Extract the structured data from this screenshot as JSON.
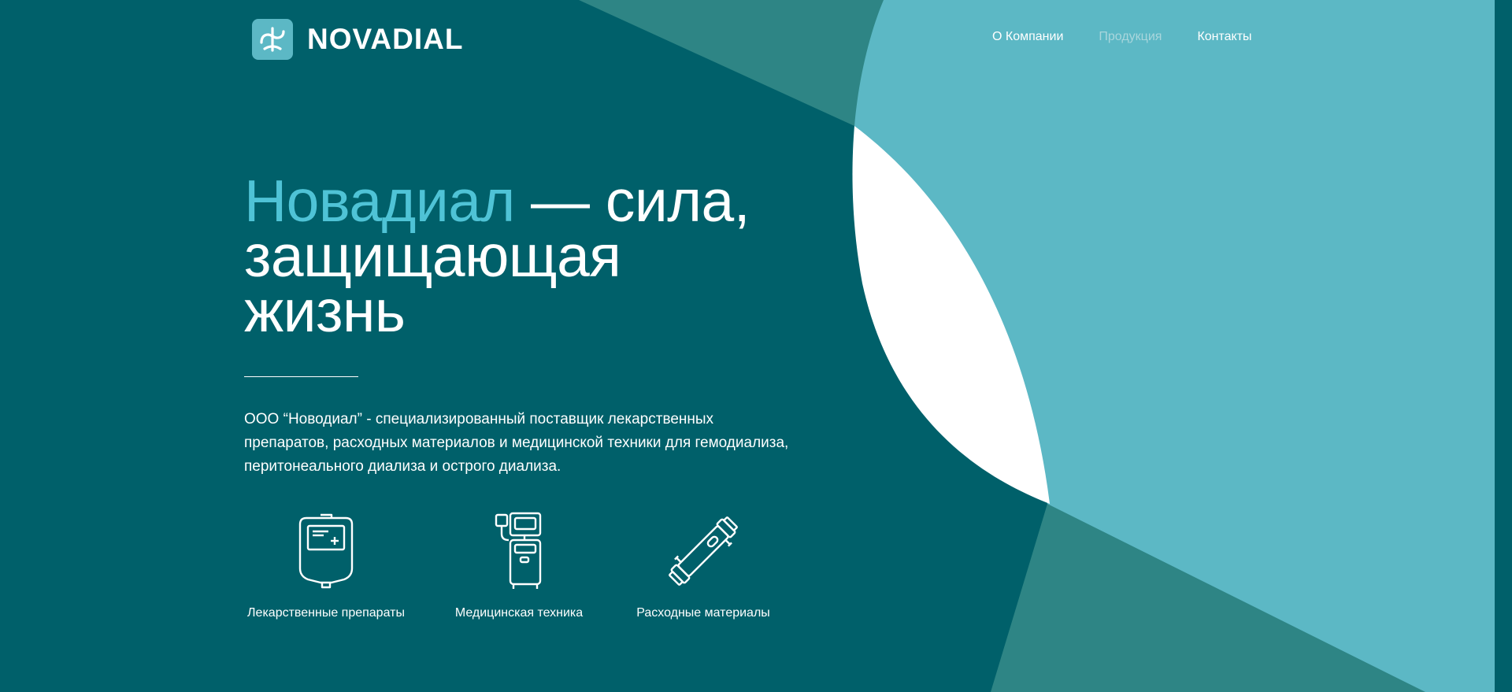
{
  "brand": {
    "name": "NOVADIAL",
    "colors": {
      "primary_bg": "#00606a",
      "accent": "#4fc3d6",
      "light_teal": "#5cb8c5",
      "mid_teal": "#2e8585"
    }
  },
  "nav": {
    "items": [
      {
        "label": "О Компании"
      },
      {
        "label": "Продукция",
        "active": true
      },
      {
        "label": "Контакты"
      }
    ]
  },
  "hero": {
    "title_accent": "Новадиал",
    "title_line1_rest": " — сила,",
    "title_line2": "защищающая",
    "title_line3": "жизнь",
    "description": "ООО “Новодиал” - специализированный поставщик лекарственных препаратов, расходных материалов и медицинской техники для гемодиализа, перитонеального диализа и острого диализа."
  },
  "categories": [
    {
      "label": "Лекарственные препараты",
      "icon": "iv-bag-icon"
    },
    {
      "label": "Медицинская техника",
      "icon": "dialysis-machine-icon"
    },
    {
      "label": "Расходные материалы",
      "icon": "dialyzer-icon"
    }
  ]
}
